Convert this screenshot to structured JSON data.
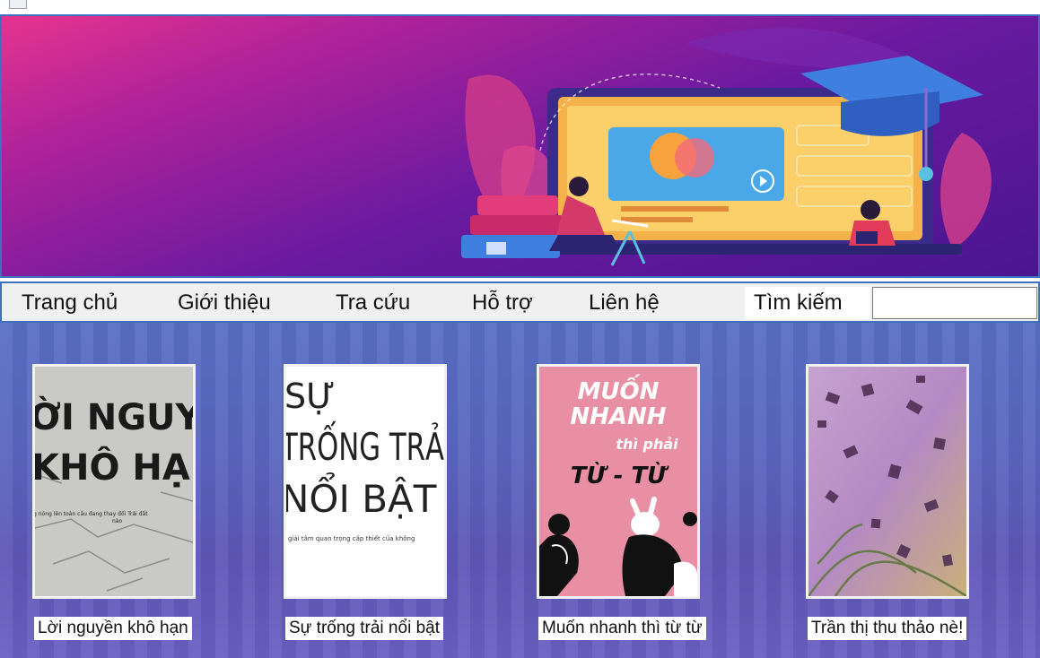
{
  "menu": {
    "items": [
      "Trang chủ",
      "Giới thiệu",
      "Tra cứu",
      "Hỗ trợ",
      "Liên hệ"
    ],
    "search_label": "Tìm kiếm",
    "search_value": ""
  },
  "books": [
    {
      "cover_lines": [
        "ỜI NGUYỀ",
        "KHÔ HẠN"
      ],
      "cover_sub": "g nóng lên toàn cầu đang thay đổi Trái đất",
      "cover_sub2": "nào",
      "caption": "Lời nguyền khô hạn"
    },
    {
      "cover_lines": [
        "SỰ",
        "TRỐNG TRẢ",
        "NỔI BẬT"
      ],
      "cover_sub": "giải tâm quan trọng cấp thiết của không",
      "caption": "Sự trống trải nổi bật"
    },
    {
      "cover_lines": [
        "MUỐN",
        "NHANH",
        "thì phải",
        "TỪ - TỪ"
      ],
      "caption": "Muốn nhanh thì từ từ"
    },
    {
      "caption": "Trần thị thu thảo nè!"
    }
  ],
  "colors": {
    "accent": "#3f6fbf",
    "banner_top": "#e6348e",
    "banner_bottom": "#4a1590",
    "content_bg": "#5a66be"
  }
}
